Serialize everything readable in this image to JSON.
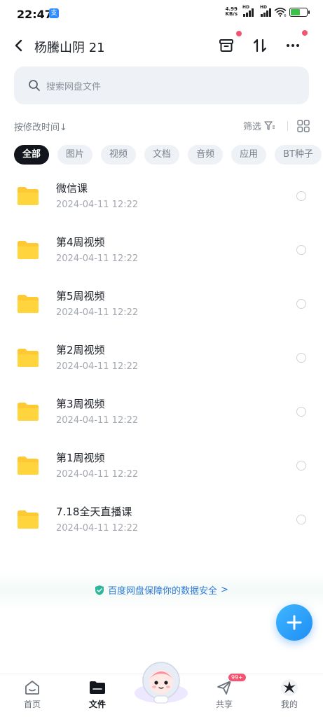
{
  "status_bar": {
    "time": "22:47",
    "app_icon": "支",
    "net_speed_value": "4.99",
    "net_speed_unit": "KB/s",
    "sig1_label": "HD",
    "sig2_label": "HD",
    "wifi_label": "6",
    "battery_icon": "battery-charging-icon"
  },
  "header": {
    "title": "杨騰山阴 21"
  },
  "search": {
    "placeholder": "搜索网盘文件"
  },
  "sort": {
    "label": "按修改时间↓",
    "filter_label": "筛选"
  },
  "chips": [
    "全部",
    "图片",
    "视频",
    "文档",
    "音频",
    "应用",
    "BT种子"
  ],
  "files": [
    {
      "name": "微信课",
      "date": "2024-04-11  12:22"
    },
    {
      "name": "第4周视频",
      "date": "2024-04-11  12:22"
    },
    {
      "name": "第5周视频",
      "date": "2024-04-11  12:22"
    },
    {
      "name": "第2周视频",
      "date": "2024-04-11  12:22"
    },
    {
      "name": "第3周视频",
      "date": "2024-04-11  12:22"
    },
    {
      "name": "第1周视频",
      "date": "2024-04-11  12:22"
    },
    {
      "name": "7.18全天直播课",
      "date": "2024-04-11  12:22"
    }
  ],
  "security": {
    "text": "百度网盘保障你的数据安全",
    "arrow": ">"
  },
  "bottom_nav": {
    "home": "首页",
    "files": "文件",
    "share": "共享",
    "share_badge": "99+",
    "mine": "我的"
  },
  "colors": {
    "accent": "#1e8ef5",
    "folder": "#ffc933",
    "red_dot": "#f45470",
    "chip_active": "#12161c"
  }
}
